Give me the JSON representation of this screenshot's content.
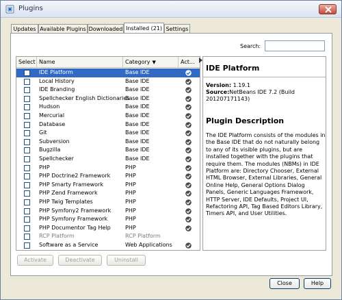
{
  "window": {
    "title": "Plugins"
  },
  "tabs": [
    {
      "label": "Updates",
      "active": false
    },
    {
      "label": "Available Plugins",
      "active": false
    },
    {
      "label": "Downloaded",
      "active": false
    },
    {
      "label": "Installed (21)",
      "active": true
    },
    {
      "label": "Settings",
      "active": false
    }
  ],
  "search": {
    "label": "Search:",
    "value": ""
  },
  "table": {
    "columns": {
      "select": "Select",
      "name": "Name",
      "category": "Category",
      "active": "Act..."
    },
    "rows": [
      {
        "name": "IDE Platform",
        "category": "Base IDE",
        "selected": true,
        "disabled": false
      },
      {
        "name": "Local History",
        "category": "Base IDE",
        "selected": false,
        "disabled": false
      },
      {
        "name": "IDE Branding",
        "category": "Base IDE",
        "selected": false,
        "disabled": false
      },
      {
        "name": "Spellchecker English Dictionaries",
        "category": "Base IDE",
        "selected": false,
        "disabled": false
      },
      {
        "name": "Hudson",
        "category": "Base IDE",
        "selected": false,
        "disabled": false
      },
      {
        "name": "Mercurial",
        "category": "Base IDE",
        "selected": false,
        "disabled": false
      },
      {
        "name": "Database",
        "category": "Base IDE",
        "selected": false,
        "disabled": false
      },
      {
        "name": "Git",
        "category": "Base IDE",
        "selected": false,
        "disabled": false
      },
      {
        "name": "Subversion",
        "category": "Base IDE",
        "selected": false,
        "disabled": false
      },
      {
        "name": "Bugzilla",
        "category": "Base IDE",
        "selected": false,
        "disabled": false
      },
      {
        "name": "Spellchecker",
        "category": "Base IDE",
        "selected": false,
        "disabled": false
      },
      {
        "name": "PHP",
        "category": "PHP",
        "selected": false,
        "disabled": false
      },
      {
        "name": "PHP Doctrine2 Framework",
        "category": "PHP",
        "selected": false,
        "disabled": false
      },
      {
        "name": "PHP Smarty Framework",
        "category": "PHP",
        "selected": false,
        "disabled": false
      },
      {
        "name": "PHP Zend Framework",
        "category": "PHP",
        "selected": false,
        "disabled": false
      },
      {
        "name": "PHP Twig Templates",
        "category": "PHP",
        "selected": false,
        "disabled": false
      },
      {
        "name": "PHP Symfony2 Framework",
        "category": "PHP",
        "selected": false,
        "disabled": false
      },
      {
        "name": "PHP Symfony Framework",
        "category": "PHP",
        "selected": false,
        "disabled": false
      },
      {
        "name": "PHP Documentor Tag Help",
        "category": "PHP",
        "selected": false,
        "disabled": false
      },
      {
        "name": "RCP Platform",
        "category": "RCP Platform",
        "selected": false,
        "disabled": true
      },
      {
        "name": "Software as a Service",
        "category": "Web Applications",
        "selected": false,
        "disabled": false
      }
    ]
  },
  "detail": {
    "title": "IDE Platform",
    "version_label": "Version:",
    "version": "1.19.1",
    "source_label": "Source:",
    "source": "NetBeans IDE 7.2 (Build 201207171143)",
    "description_heading": "Plugin Description",
    "description": "The IDE Platform consists of the modules in the Base IDE that do not naturally belong to any of its visible plugins, but are installed together with the plugins that require them. The modules (NBMs) in IDE Platform are: Directory Chooser, External HTML Browser, External Libraries, General Online Help, General Options Dialog Panels, Generic Languages Framework, HTTP Server, IDE Defaults, Project UI, Refactoring API, Tag Based Editors Library, Timers API, and User Utilities."
  },
  "actions": {
    "activate": "Activate",
    "deactivate": "Deactivate",
    "uninstall": "Uninstall"
  },
  "footer": {
    "close": "Close",
    "help": "Help"
  },
  "colors": {
    "selection": "#316ac5",
    "panel_bg": "#ece9d8",
    "active_check": "#4a4a4a"
  }
}
